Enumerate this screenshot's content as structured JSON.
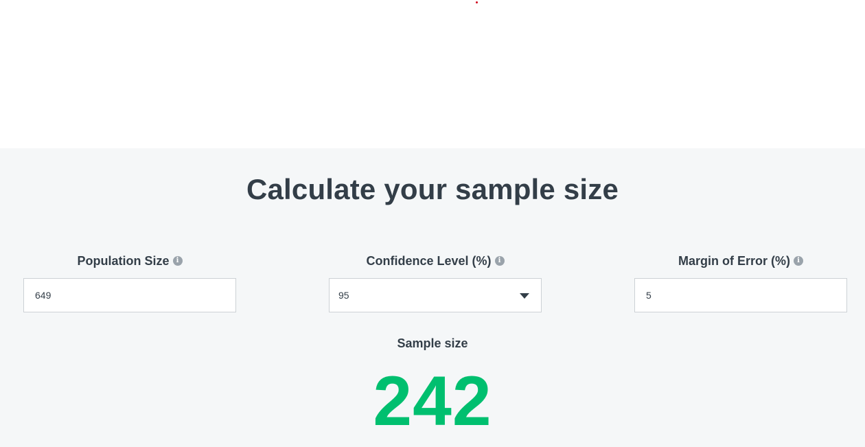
{
  "calculator": {
    "title": "Calculate your sample size",
    "population": {
      "label": "Population Size",
      "value": "649",
      "info_icon": "info-icon"
    },
    "confidence": {
      "label": "Confidence Level (%)",
      "selected": "95",
      "info_icon": "info-icon"
    },
    "margin": {
      "label": "Margin of Error (%)",
      "value": "5",
      "info_icon": "info-icon"
    },
    "result": {
      "label": "Sample size",
      "value": "242"
    }
  },
  "colors": {
    "background": "#f5f7f8",
    "text": "#333e48",
    "accent": "#00bf6f",
    "border": "#ccd1d5"
  }
}
